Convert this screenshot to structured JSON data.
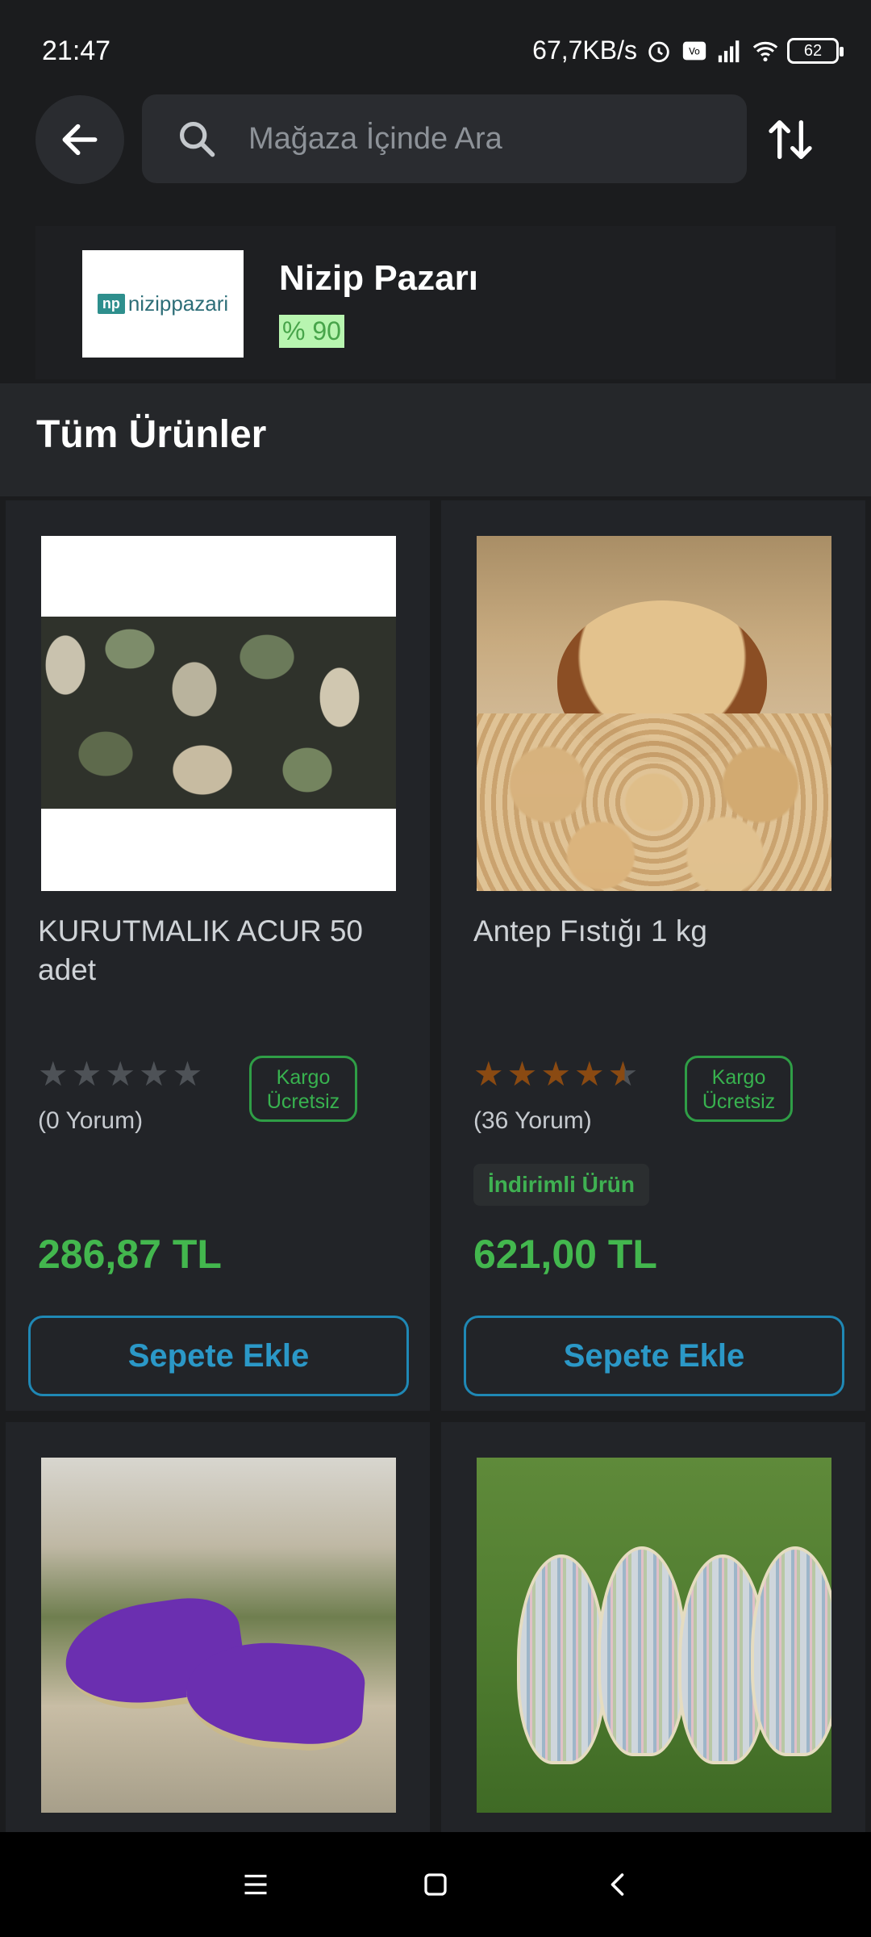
{
  "status_bar": {
    "time": "21:47",
    "network_speed": "67,7KB/s",
    "battery": "62",
    "icons": [
      "alarm-icon",
      "volte-icon",
      "signal-icon",
      "wifi-icon",
      "battery-icon"
    ]
  },
  "top_bar": {
    "back_icon": "arrow-left-icon",
    "search_placeholder": "Mağaza İçinde Ara",
    "sort_icon": "sort-arrows-icon"
  },
  "store": {
    "logo_mark": "np",
    "logo_text": "nizippazari",
    "name": "Nizip Pazarı",
    "rating": "% 90"
  },
  "section": {
    "title": "Tüm Ürünler"
  },
  "products": [
    {
      "name": "KURUTMALIK ACUR 50 adet",
      "rating": 0,
      "reviews": "(0 Yorum)",
      "shipping_badge": "Kargo Ücretsiz",
      "discount_badge": "",
      "price": "286,87 TL",
      "button": "Sepete Ekle"
    },
    {
      "name": "Antep Fıstığı 1 kg",
      "rating": 4.5,
      "reviews": "(36 Yorum)",
      "shipping_badge": "Kargo Ücretsiz",
      "discount_badge": "İndirimli Ürün",
      "price": "621,00 TL",
      "button": "Sepete Ekle"
    }
  ],
  "colors": {
    "background": "#1b1c1e",
    "price": "#43b74e",
    "button_border": "#1f88b5",
    "star_on": "#8a4a12"
  }
}
